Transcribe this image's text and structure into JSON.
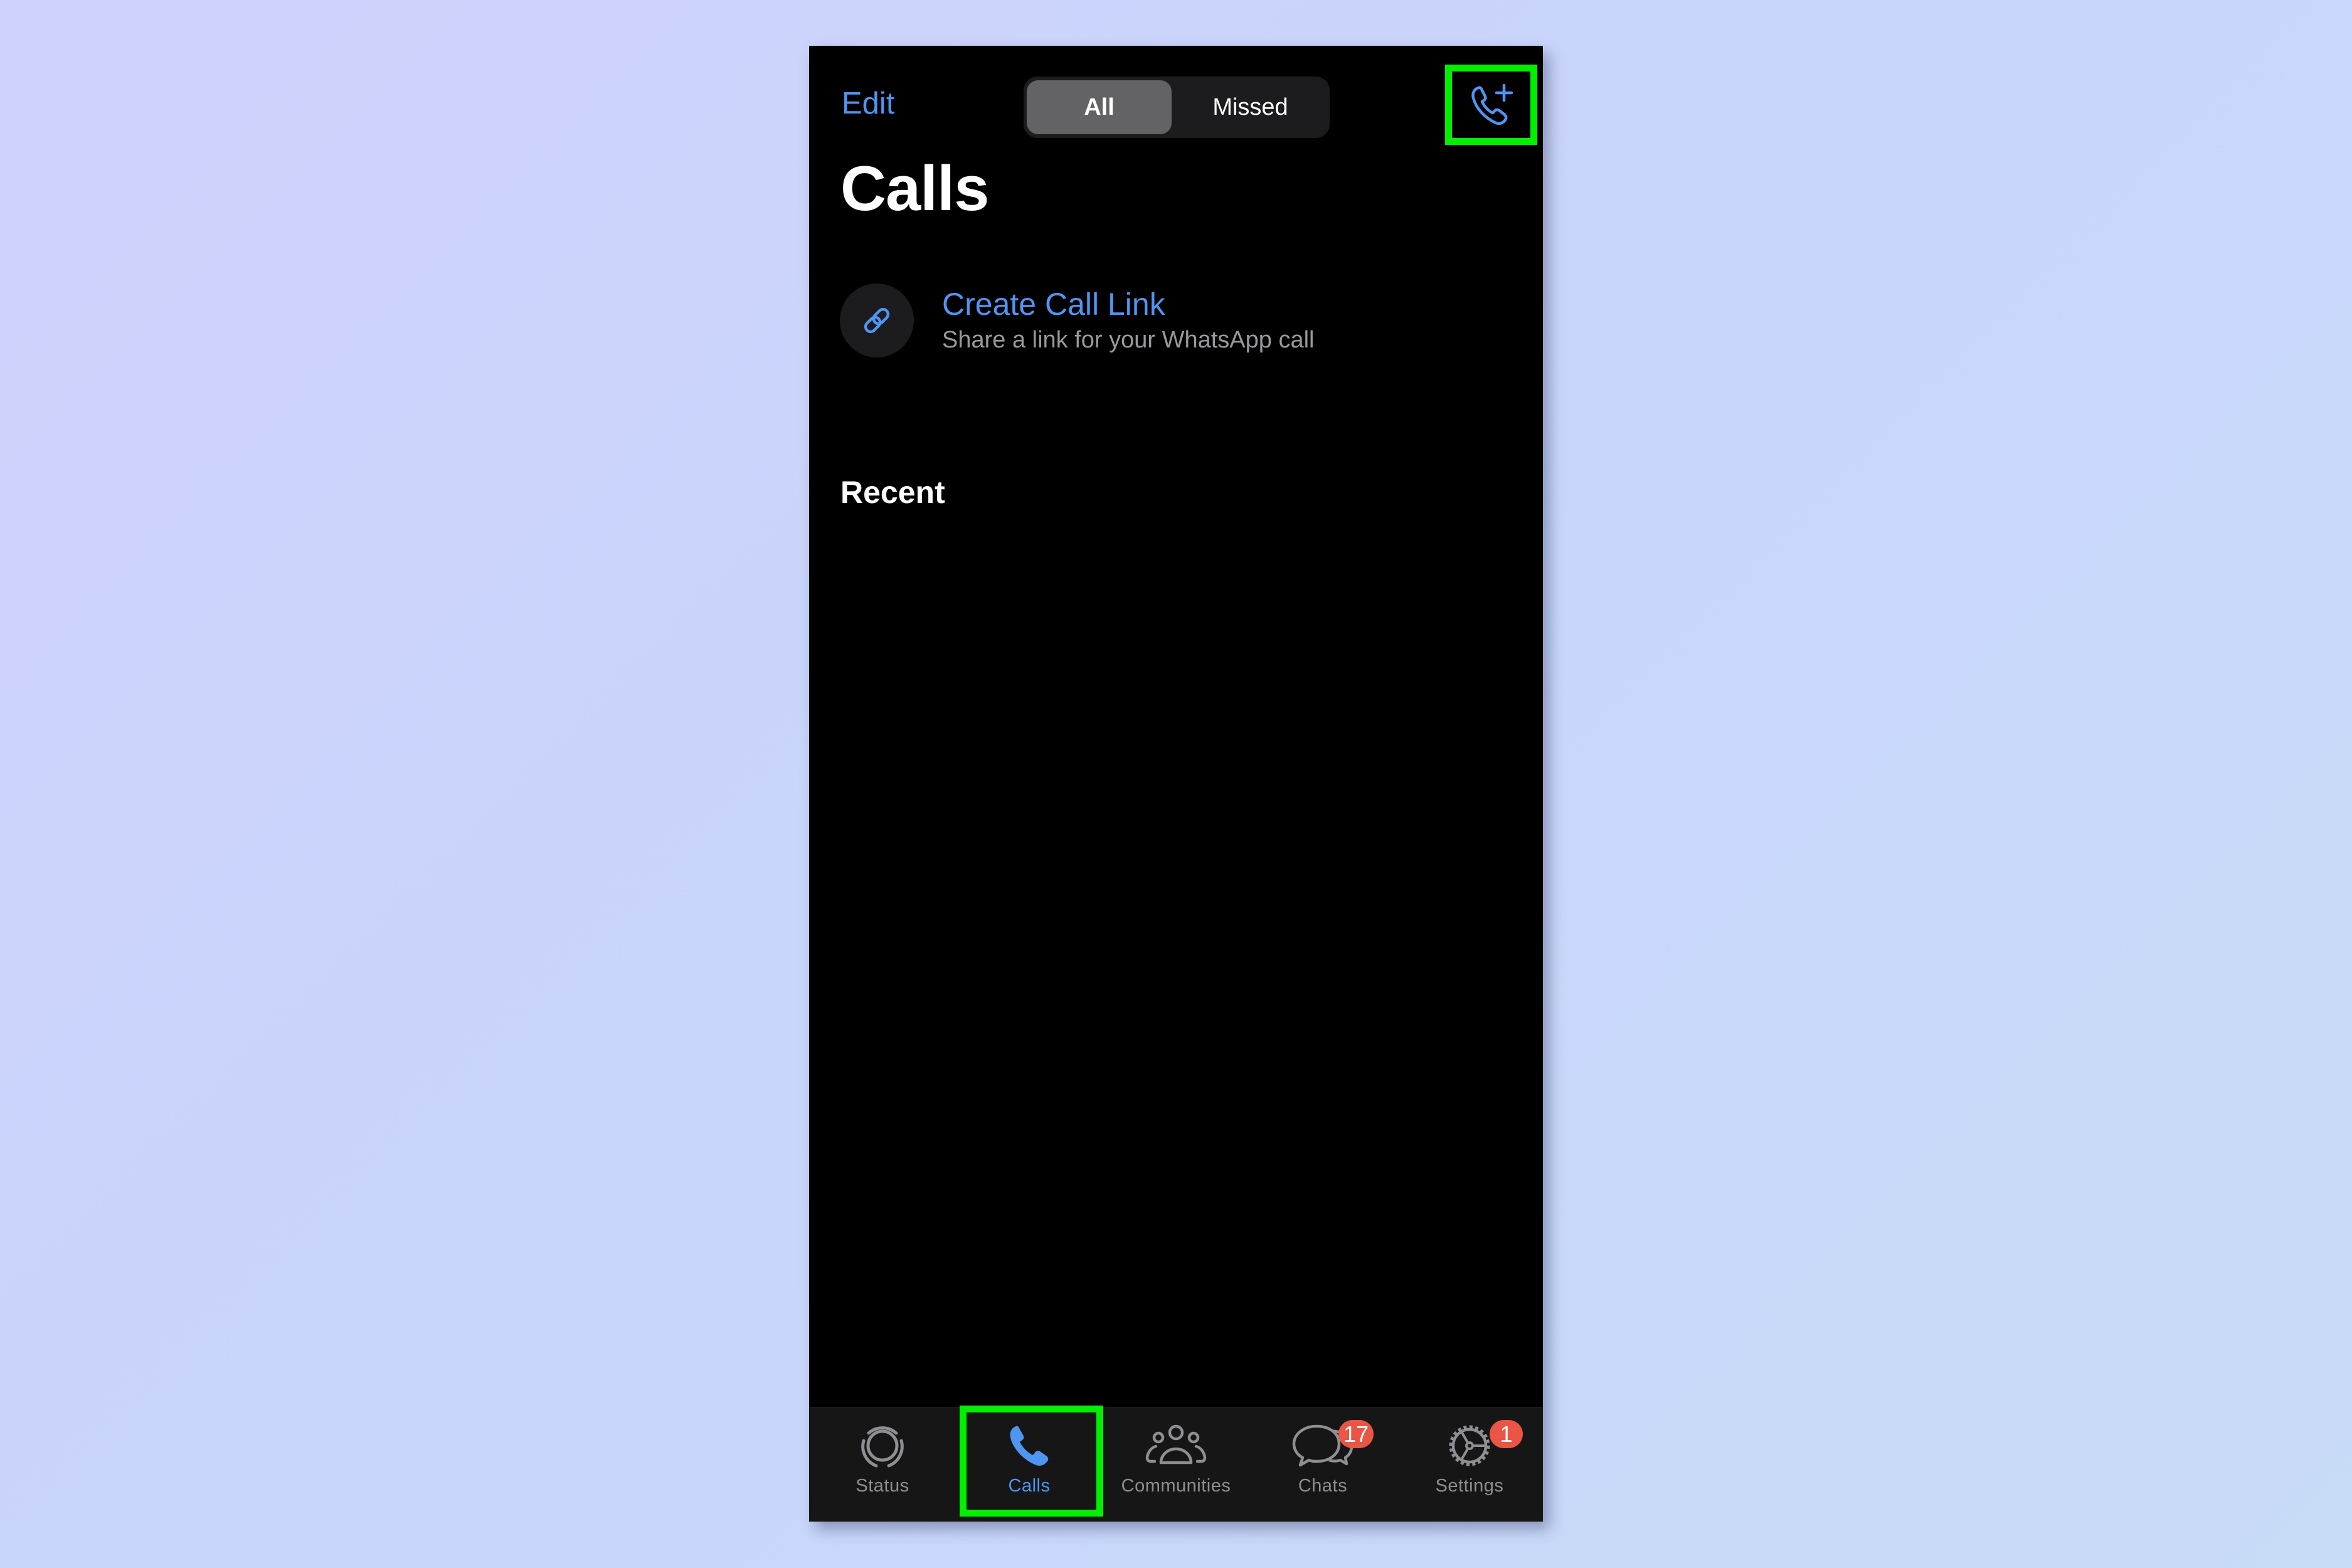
{
  "header": {
    "edit_label": "Edit",
    "segments": [
      {
        "label": "All",
        "selected": true
      },
      {
        "label": "Missed",
        "selected": false
      }
    ],
    "new_call_icon": "phone-plus-icon",
    "title": "Calls"
  },
  "call_link": {
    "icon": "link-icon",
    "title": "Create Call Link",
    "subtitle": "Share a link for your WhatsApp call"
  },
  "recent": {
    "heading": "Recent"
  },
  "tabbar": {
    "tabs": [
      {
        "label": "Status",
        "icon": "status-icon",
        "active": false,
        "badge": null
      },
      {
        "label": "Calls",
        "icon": "phone-icon",
        "active": true,
        "badge": null
      },
      {
        "label": "Communities",
        "icon": "communities-icon",
        "active": false,
        "badge": null
      },
      {
        "label": "Chats",
        "icon": "chat-bubbles-icon",
        "active": false,
        "badge": "17"
      },
      {
        "label": "Settings",
        "icon": "gear-icon",
        "active": false,
        "badge": "1"
      }
    ]
  },
  "annotations": {
    "highlight_color": "#00f000",
    "highlighted": [
      "new-call-button",
      "tab-calls"
    ]
  },
  "colors": {
    "accent": "#4f95f2",
    "badge": "#eb5545",
    "inactive": "#8e8e93"
  }
}
